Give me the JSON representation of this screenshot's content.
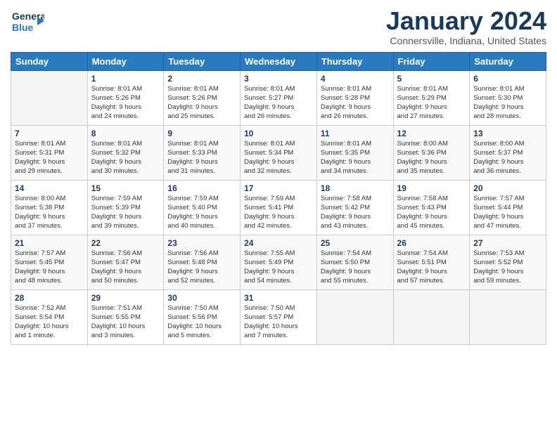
{
  "header": {
    "logo_line1": "General",
    "logo_line2": "Blue",
    "month_title": "January 2024",
    "location": "Connersville, Indiana, United States"
  },
  "days_of_week": [
    "Sunday",
    "Monday",
    "Tuesday",
    "Wednesday",
    "Thursday",
    "Friday",
    "Saturday"
  ],
  "weeks": [
    [
      {
        "day": "",
        "info": ""
      },
      {
        "day": "1",
        "info": "Sunrise: 8:01 AM\nSunset: 5:26 PM\nDaylight: 9 hours\nand 24 minutes."
      },
      {
        "day": "2",
        "info": "Sunrise: 8:01 AM\nSunset: 5:26 PM\nDaylight: 9 hours\nand 25 minutes."
      },
      {
        "day": "3",
        "info": "Sunrise: 8:01 AM\nSunset: 5:27 PM\nDaylight: 9 hours\nand 26 minutes."
      },
      {
        "day": "4",
        "info": "Sunrise: 8:01 AM\nSunset: 5:28 PM\nDaylight: 9 hours\nand 26 minutes."
      },
      {
        "day": "5",
        "info": "Sunrise: 8:01 AM\nSunset: 5:29 PM\nDaylight: 9 hours\nand 27 minutes."
      },
      {
        "day": "6",
        "info": "Sunrise: 8:01 AM\nSunset: 5:30 PM\nDaylight: 9 hours\nand 28 minutes."
      }
    ],
    [
      {
        "day": "7",
        "info": "Sunrise: 8:01 AM\nSunset: 5:31 PM\nDaylight: 9 hours\nand 29 minutes."
      },
      {
        "day": "8",
        "info": "Sunrise: 8:01 AM\nSunset: 5:32 PM\nDaylight: 9 hours\nand 30 minutes."
      },
      {
        "day": "9",
        "info": "Sunrise: 8:01 AM\nSunset: 5:33 PM\nDaylight: 9 hours\nand 31 minutes."
      },
      {
        "day": "10",
        "info": "Sunrise: 8:01 AM\nSunset: 5:34 PM\nDaylight: 9 hours\nand 32 minutes."
      },
      {
        "day": "11",
        "info": "Sunrise: 8:01 AM\nSunset: 5:35 PM\nDaylight: 9 hours\nand 34 minutes."
      },
      {
        "day": "12",
        "info": "Sunrise: 8:00 AM\nSunset: 5:36 PM\nDaylight: 9 hours\nand 35 minutes."
      },
      {
        "day": "13",
        "info": "Sunrise: 8:00 AM\nSunset: 5:37 PM\nDaylight: 9 hours\nand 36 minutes."
      }
    ],
    [
      {
        "day": "14",
        "info": "Sunrise: 8:00 AM\nSunset: 5:38 PM\nDaylight: 9 hours\nand 37 minutes."
      },
      {
        "day": "15",
        "info": "Sunrise: 7:59 AM\nSunset: 5:39 PM\nDaylight: 9 hours\nand 39 minutes."
      },
      {
        "day": "16",
        "info": "Sunrise: 7:59 AM\nSunset: 5:40 PM\nDaylight: 9 hours\nand 40 minutes."
      },
      {
        "day": "17",
        "info": "Sunrise: 7:59 AM\nSunset: 5:41 PM\nDaylight: 9 hours\nand 42 minutes."
      },
      {
        "day": "18",
        "info": "Sunrise: 7:58 AM\nSunset: 5:42 PM\nDaylight: 9 hours\nand 43 minutes."
      },
      {
        "day": "19",
        "info": "Sunrise: 7:58 AM\nSunset: 5:43 PM\nDaylight: 9 hours\nand 45 minutes."
      },
      {
        "day": "20",
        "info": "Sunrise: 7:57 AM\nSunset: 5:44 PM\nDaylight: 9 hours\nand 47 minutes."
      }
    ],
    [
      {
        "day": "21",
        "info": "Sunrise: 7:57 AM\nSunset: 5:45 PM\nDaylight: 9 hours\nand 48 minutes."
      },
      {
        "day": "22",
        "info": "Sunrise: 7:56 AM\nSunset: 5:47 PM\nDaylight: 9 hours\nand 50 minutes."
      },
      {
        "day": "23",
        "info": "Sunrise: 7:56 AM\nSunset: 5:48 PM\nDaylight: 9 hours\nand 52 minutes."
      },
      {
        "day": "24",
        "info": "Sunrise: 7:55 AM\nSunset: 5:49 PM\nDaylight: 9 hours\nand 54 minutes."
      },
      {
        "day": "25",
        "info": "Sunrise: 7:54 AM\nSunset: 5:50 PM\nDaylight: 9 hours\nand 55 minutes."
      },
      {
        "day": "26",
        "info": "Sunrise: 7:54 AM\nSunset: 5:51 PM\nDaylight: 9 hours\nand 57 minutes."
      },
      {
        "day": "27",
        "info": "Sunrise: 7:53 AM\nSunset: 5:52 PM\nDaylight: 9 hours\nand 59 minutes."
      }
    ],
    [
      {
        "day": "28",
        "info": "Sunrise: 7:52 AM\nSunset: 5:54 PM\nDaylight: 10 hours\nand 1 minute."
      },
      {
        "day": "29",
        "info": "Sunrise: 7:51 AM\nSunset: 5:55 PM\nDaylight: 10 hours\nand 3 minutes."
      },
      {
        "day": "30",
        "info": "Sunrise: 7:50 AM\nSunset: 5:56 PM\nDaylight: 10 hours\nand 5 minutes."
      },
      {
        "day": "31",
        "info": "Sunrise: 7:50 AM\nSunset: 5:57 PM\nDaylight: 10 hours\nand 7 minutes."
      },
      {
        "day": "",
        "info": ""
      },
      {
        "day": "",
        "info": ""
      },
      {
        "day": "",
        "info": ""
      }
    ]
  ]
}
